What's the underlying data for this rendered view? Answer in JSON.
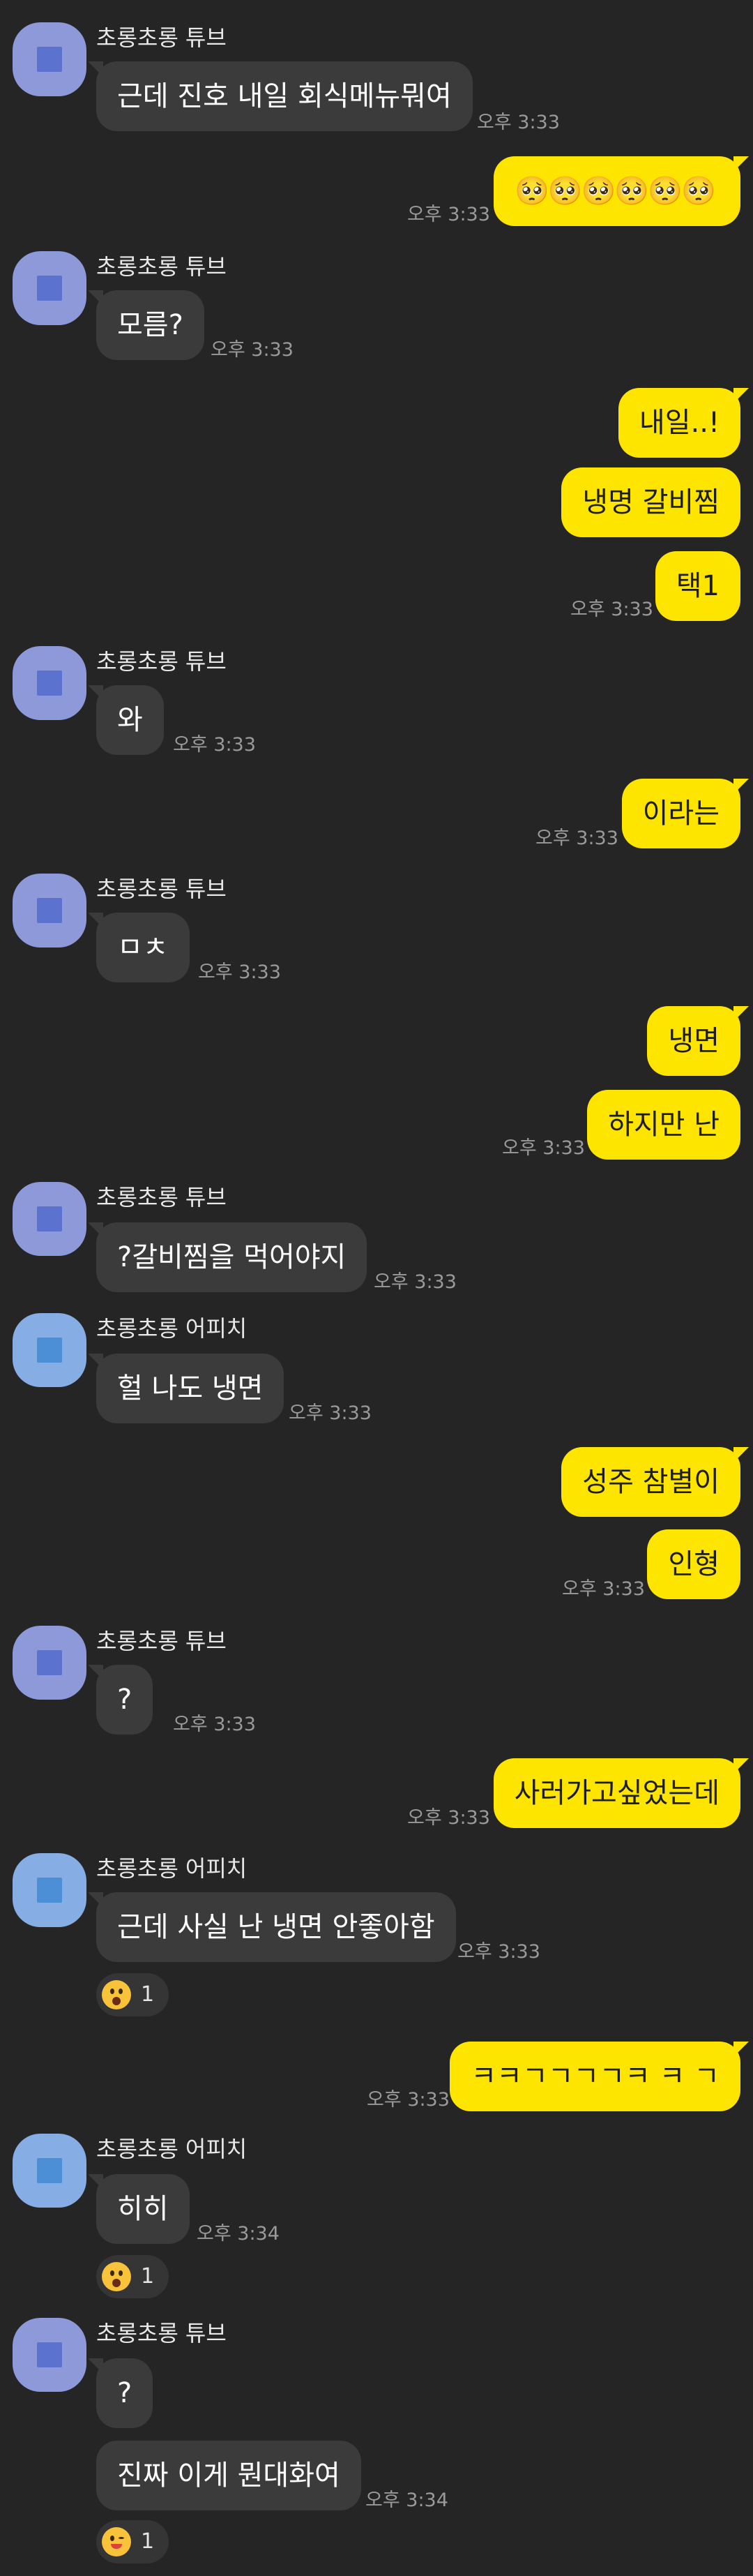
{
  "chat": {
    "messages": [
      {
        "sender": "초롱초롱 튜브",
        "text": "근데 진호 내일 회식메뉴뭐여",
        "time": "오후 3:33"
      },
      {
        "text": "🥺🥺🥺🥺🥺🥺",
        "time": "오후 3:33"
      },
      {
        "sender": "초롱초롱 튜브",
        "text": "모름?",
        "time": "오후 3:33"
      },
      {
        "text": "내일..!"
      },
      {
        "text": "냉명 갈비찜"
      },
      {
        "text": "택1",
        "time": "오후 3:33"
      },
      {
        "sender": "초롱초롱 튜브",
        "text": "와",
        "time": "오후 3:33"
      },
      {
        "text": "이라는",
        "time": "오후 3:33"
      },
      {
        "sender": "초롱초롱 튜브",
        "text": "ㅁㅊ",
        "time": "오후 3:33"
      },
      {
        "text": "냉면"
      },
      {
        "text": "하지만 난",
        "time": "오후 3:33"
      },
      {
        "sender": "초롱초롱 튜브",
        "text": "?갈비찜을 먹어야지",
        "time": "오후 3:33"
      },
      {
        "sender": "초롱초롱 어피치",
        "text": "헐 나도 냉면",
        "time": "오후 3:33"
      },
      {
        "text": "성주 참별이"
      },
      {
        "text": "인형",
        "time": "오후 3:33"
      },
      {
        "sender": "초롱초롱 튜브",
        "text": "?",
        "time": "오후 3:33"
      },
      {
        "text": "사러가고싶었는데",
        "time": "오후 3:33"
      },
      {
        "sender": "초롱초롱 어피치",
        "text": "근데 사실 난 냉면 안좋아함",
        "time": "오후 3:33",
        "reaction": {
          "icon": "surprised-emoji-icon",
          "count": "1"
        }
      },
      {
        "text": "ㅋㅋㄱㄱㄱㄱㅋ ㅋ ㄱ",
        "time": "오후 3:33"
      },
      {
        "sender": "초롱초롱 어피치",
        "text": "히히",
        "time": "오후 3:34",
        "reaction": {
          "icon": "surprised-emoji-icon",
          "count": "1"
        }
      },
      {
        "sender": "초롱초롱 튜브",
        "text": "?"
      },
      {
        "text": "진짜 이게 뭔대화여",
        "time": "오후 3:34",
        "reaction": {
          "icon": "wink-emoji-icon",
          "count": "1"
        }
      }
    ]
  },
  "colors": {
    "background": "#252525",
    "incoming_bubble": "#3b3b3b",
    "outgoing_bubble": "#fee500",
    "timestamp": "#9a9a9a"
  }
}
